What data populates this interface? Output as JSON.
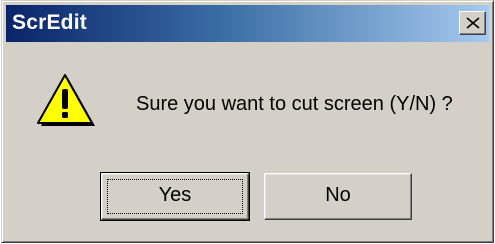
{
  "dialog": {
    "title": "ScrEdit",
    "close_icon": "close-x-icon",
    "warning_icon": "warning-triangle-exclamation-icon",
    "message": "Sure you want to cut screen (Y/N) ?",
    "buttons": {
      "yes_label": "Yes",
      "no_label": "No"
    }
  },
  "colors": {
    "title_gradient_start": "#0a246a",
    "title_gradient_end": "#a6caf0",
    "dialog_face": "#d4d0c8",
    "warning_fill": "#ffff00"
  }
}
